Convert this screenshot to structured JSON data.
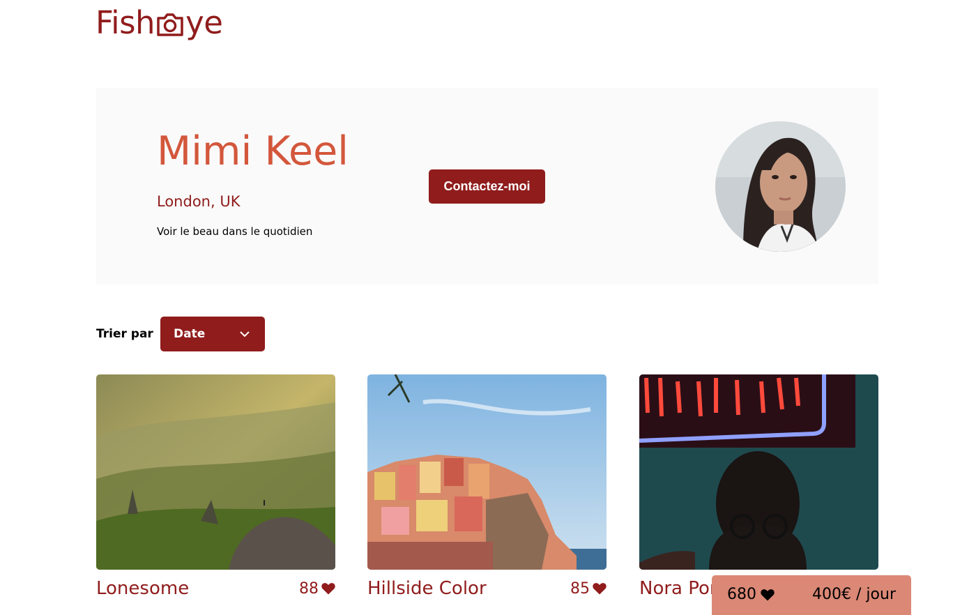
{
  "logo": {
    "text_before": "Fish",
    "text_after": "ye",
    "icon": "camera-icon"
  },
  "photographer": {
    "name": "Mimi Keel",
    "location": "London, UK",
    "tagline": "Voir le beau dans le quotidien",
    "contact_label": "Contactez-moi"
  },
  "sort": {
    "label": "Trier par",
    "selected": "Date",
    "icon": "chevron-down-icon"
  },
  "media": [
    {
      "title": "Lonesome",
      "likes": "88",
      "icon": "heart-icon"
    },
    {
      "title": "Hillside Color",
      "likes": "85",
      "icon": "heart-icon"
    },
    {
      "title": "Nora Portrait",
      "likes": "",
      "icon": "heart-icon"
    }
  ],
  "sticky": {
    "total_likes": "680",
    "price": "400€ / jour"
  },
  "colors": {
    "primary": "#901C1C",
    "accent": "#D3573C",
    "sticky_bg": "#DB8876",
    "header_bg": "#FAFAFA"
  }
}
